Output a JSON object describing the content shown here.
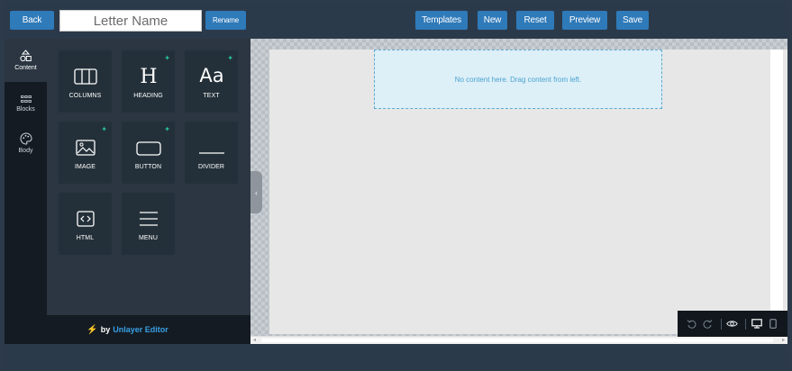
{
  "toolbar": {
    "back_label": "Back",
    "name_value": "Letter Name",
    "rename_label": "Rename",
    "templates_label": "Templates",
    "new_label": "New",
    "reset_label": "Reset",
    "preview_label": "Preview",
    "save_label": "Save"
  },
  "sidebar": {
    "items": [
      {
        "label": "Content",
        "icon": "shapes-icon"
      },
      {
        "label": "Blocks",
        "icon": "grid-icon"
      },
      {
        "label": "Body",
        "icon": "palette-icon"
      }
    ]
  },
  "tools": [
    {
      "label": "COLUMNS",
      "icon": "columns-icon"
    },
    {
      "label": "HEADING",
      "icon": "heading-icon"
    },
    {
      "label": "TEXT",
      "icon": "text-icon"
    },
    {
      "label": "IMAGE",
      "icon": "image-icon"
    },
    {
      "label": "BUTTON",
      "icon": "button-icon"
    },
    {
      "label": "DIVIDER",
      "icon": "divider-icon"
    },
    {
      "label": "HTML",
      "icon": "html-icon"
    },
    {
      "label": "MENU",
      "icon": "menu-icon"
    }
  ],
  "footer": {
    "prefix": "by",
    "brand": "Unlayer Editor"
  },
  "canvas": {
    "placeholder": "No content here. Drag content from left."
  },
  "colors": {
    "accent": "#2f7ab9",
    "new_badge": "#28c19a",
    "brand_link": "#3aa0e6"
  }
}
